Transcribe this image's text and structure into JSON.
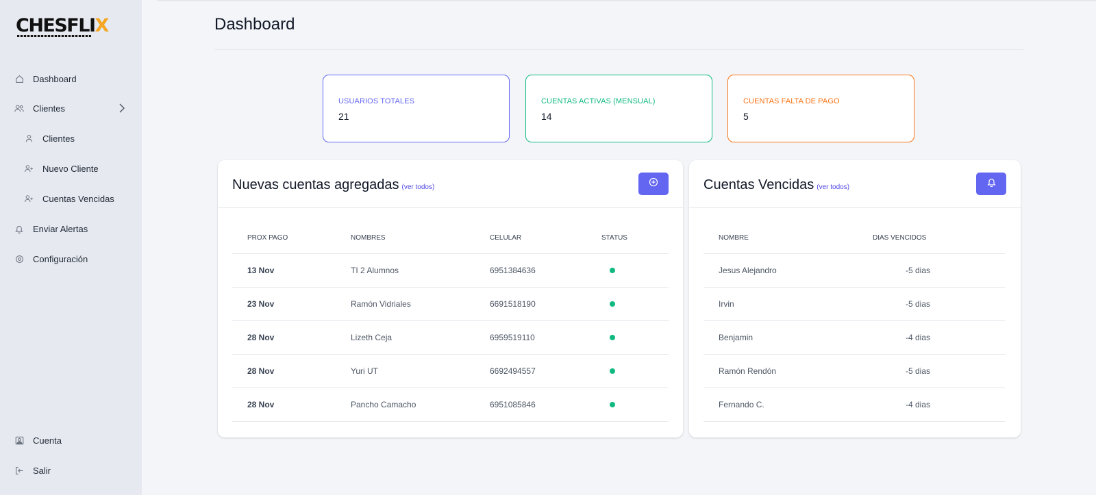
{
  "brand": {
    "logo_main": "CHESFLI",
    "logo_accent": "X"
  },
  "sidebar": {
    "items": [
      {
        "label": "Dashboard",
        "icon": "home-icon"
      },
      {
        "label": "Clientes",
        "icon": "users-icon"
      },
      {
        "label": "Clientes",
        "icon": "user-icon"
      },
      {
        "label": "Nuevo Cliente",
        "icon": "user-plus-icon"
      },
      {
        "label": "Cuentas Vencidas",
        "icon": "user-plus-icon"
      },
      {
        "label": "Enviar Alertas",
        "icon": "bell-icon"
      },
      {
        "label": "Configuración",
        "icon": "gear-icon"
      }
    ],
    "bottom": [
      {
        "label": "Cuenta",
        "icon": "account-icon"
      },
      {
        "label": "Salir",
        "icon": "logout-icon"
      }
    ]
  },
  "page": {
    "title": "Dashboard"
  },
  "stats": [
    {
      "label": "USUARIOS TOTALES",
      "value": "21",
      "color": "#6366f1"
    },
    {
      "label": "CUENTAS ACTIVAS (MENSUAL)",
      "value": "14",
      "color": "#10b981"
    },
    {
      "label": "CUENTAS FALTA DE PAGO",
      "value": "5",
      "color": "#f97316"
    }
  ],
  "new_accounts": {
    "title": "Nuevas cuentas agregadas",
    "link": "(ver todos)",
    "button_icon": "plus-circle-icon",
    "columns": [
      "PROX PAGO",
      "NOMBRES",
      "CELULAR",
      "STATUS"
    ],
    "rows": [
      {
        "date": "13 Nov",
        "name": "TI 2 Alumnos",
        "phone": "6951384636",
        "status": "active"
      },
      {
        "date": "23 Nov",
        "name": "Ramón Vidriales",
        "phone": "6691518190",
        "status": "active"
      },
      {
        "date": "28 Nov",
        "name": "Lizeth Ceja",
        "phone": "6959519110",
        "status": "active"
      },
      {
        "date": "28 Nov",
        "name": "Yuri UT",
        "phone": "6692494557",
        "status": "active"
      },
      {
        "date": "28 Nov",
        "name": "Pancho Camacho",
        "phone": "6951085846",
        "status": "active"
      }
    ]
  },
  "expired_accounts": {
    "title": "Cuentas Vencidas",
    "link": "(ver todos)",
    "button_icon": "bell-icon",
    "columns": [
      "NOMBRE",
      "DIAS VENCIDOS"
    ],
    "rows": [
      {
        "name": "Jesus Alejandro",
        "days": "-5 dias"
      },
      {
        "name": "Irvin",
        "days": "-5 dias"
      },
      {
        "name": "Benjamin",
        "days": "-4 dias"
      },
      {
        "name": "Ramón Rendón",
        "days": "-5 dias"
      },
      {
        "name": "Fernando C.",
        "days": "-4 dias"
      }
    ]
  },
  "colors": {
    "accent": "#6366f1",
    "status_active": "#10b981",
    "sidebar_bg": "#e6e9ef",
    "page_bg": "#f3f5f8"
  }
}
